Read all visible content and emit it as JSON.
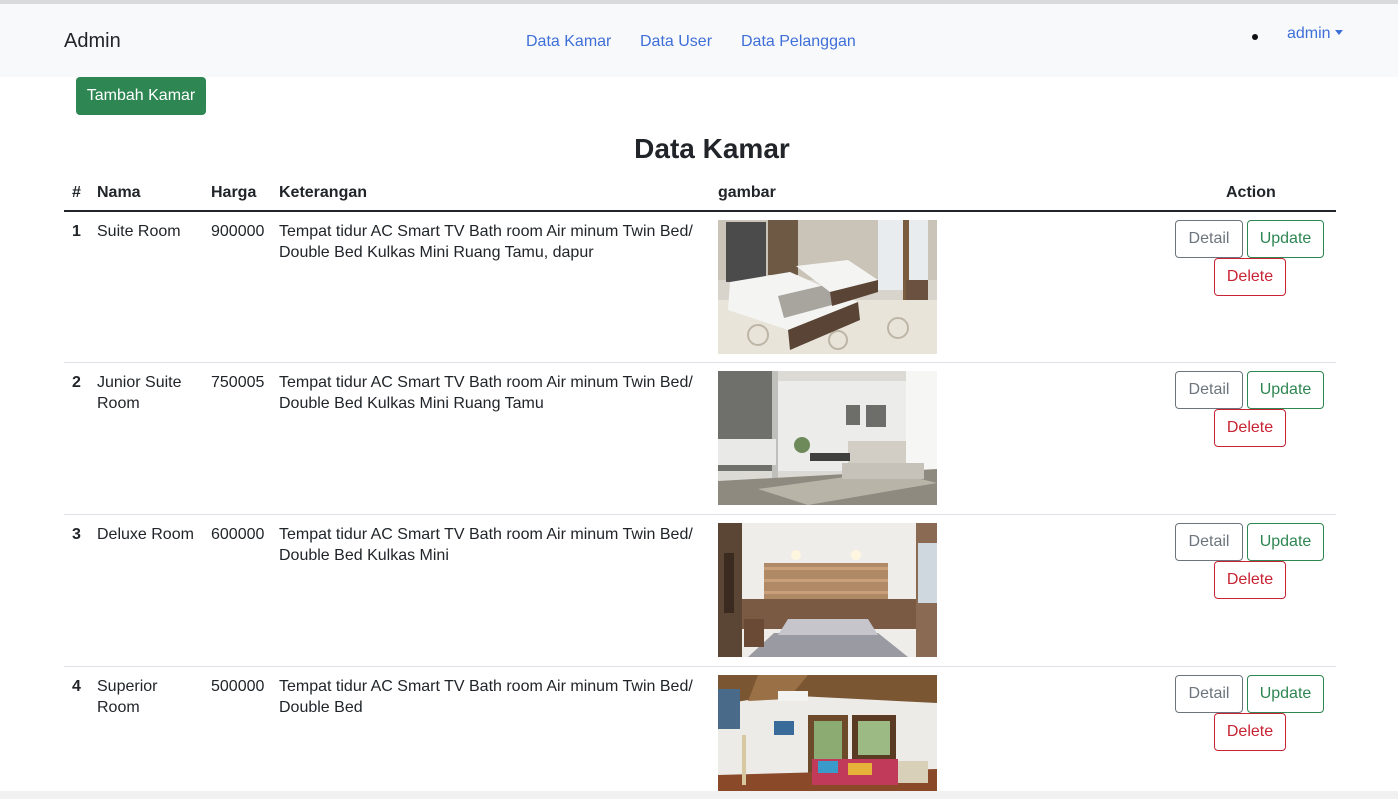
{
  "navbar": {
    "brand": "Admin",
    "links": [
      "Data Kamar",
      "Data User",
      "Data Pelanggan"
    ],
    "user_menu": "admin"
  },
  "toolbar": {
    "add_label": "Tambah Kamar"
  },
  "page": {
    "title": "Data Kamar"
  },
  "table": {
    "headers": [
      "#",
      "Nama",
      "Harga",
      "Keterangan",
      "gambar",
      "Action"
    ],
    "rows": [
      {
        "no": "1",
        "nama": "Suite Room",
        "harga": "900000",
        "keterangan": "Tempat tidur AC Smart TV Bath room Air minum Twin Bed/ Double Bed Kulkas Mini Ruang Tamu, dapur",
        "actions": {
          "detail": "Detail",
          "update": "Update",
          "delete": "Delete"
        }
      },
      {
        "no": "2",
        "nama": "Junior Suite Room",
        "harga": "750005",
        "keterangan": "Tempat tidur AC Smart TV Bath room Air minum Twin Bed/ Double Bed Kulkas Mini Ruang Tamu",
        "actions": {
          "detail": "Detail",
          "update": "Update",
          "delete": "Delete"
        }
      },
      {
        "no": "3",
        "nama": "Deluxe Room",
        "harga": "600000",
        "keterangan": "Tempat tidur AC Smart TV Bath room Air minum Twin Bed/ Double Bed Kulkas Mini",
        "actions": {
          "detail": "Detail",
          "update": "Update",
          "delete": "Delete"
        }
      },
      {
        "no": "4",
        "nama": "Superior Room",
        "harga": "500000",
        "keterangan": "Tempat tidur AC Smart TV Bath room Air minum Twin Bed/ Double Bed",
        "actions": {
          "detail": "Detail",
          "update": "Update",
          "delete": "Delete"
        }
      }
    ]
  },
  "colors": {
    "navbar_bg": "#f8f9fa",
    "link": "#3f6fd8",
    "success": "#2e8652",
    "secondary": "#6c757d",
    "danger": "#c82333"
  }
}
